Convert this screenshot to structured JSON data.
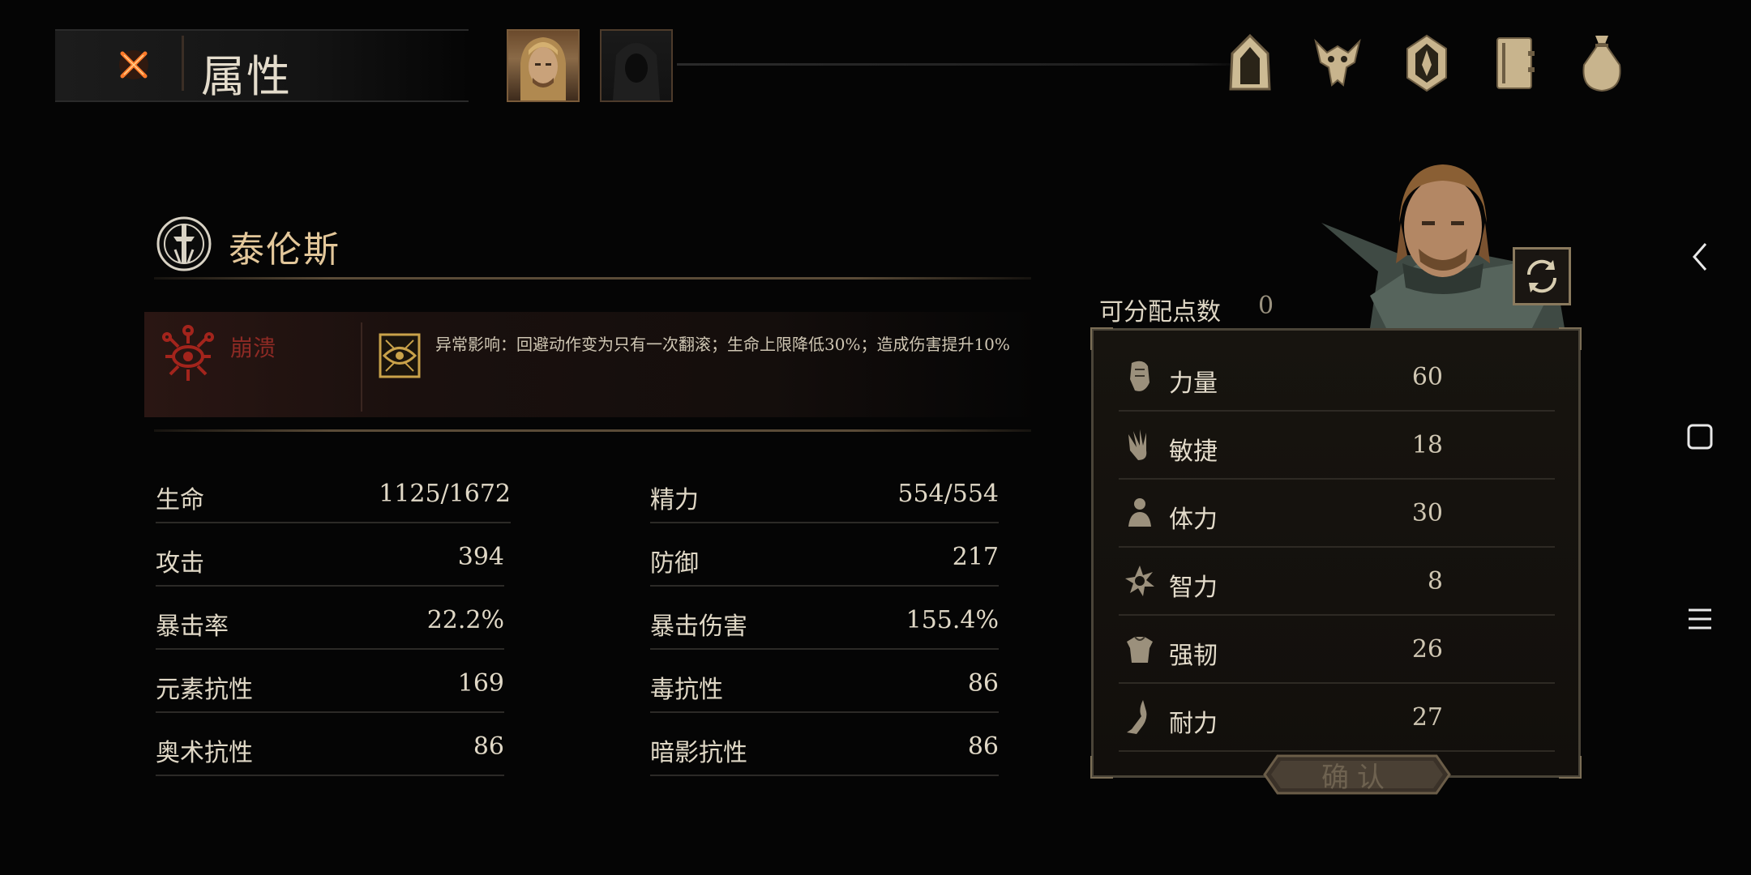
{
  "header": {
    "title": "属性"
  },
  "character": {
    "name": "泰伦斯"
  },
  "debuff": {
    "name": "崩溃",
    "description": "异常影响：回避动作变为只有一次翻滚；生命上限降低30%；造成伤害提升10%"
  },
  "stats": [
    {
      "label": "生命",
      "value": "1125/1672",
      "label2": "精力",
      "value2": "554/554"
    },
    {
      "label": "攻击",
      "value": "394",
      "label2": "防御",
      "value2": "217"
    },
    {
      "label": "暴击率",
      "value": "22.2%",
      "label2": "暴击伤害",
      "value2": "155.4%"
    },
    {
      "label": "元素抗性",
      "value": "169",
      "label2": "毒抗性",
      "value2": "86"
    },
    {
      "label": "奥术抗性",
      "value": "86",
      "label2": "暗影抗性",
      "value2": "86"
    }
  ],
  "attributes": {
    "points_label": "可分配点数",
    "points_value": "0",
    "items": [
      {
        "label": "力量",
        "value": "60",
        "icon": "fist-icon"
      },
      {
        "label": "敏捷",
        "value": "18",
        "icon": "hand-icon"
      },
      {
        "label": "体力",
        "value": "30",
        "icon": "body-icon"
      },
      {
        "label": "智力",
        "value": "8",
        "icon": "burst-icon"
      },
      {
        "label": "强韧",
        "value": "26",
        "icon": "armor-icon"
      },
      {
        "label": "耐力",
        "value": "27",
        "icon": "leg-icon"
      }
    ],
    "confirm_label": "确认"
  },
  "colors": {
    "gold": "#e3c79a",
    "debuff_red": "#8e2a24",
    "close_orange": "#e0602a"
  }
}
